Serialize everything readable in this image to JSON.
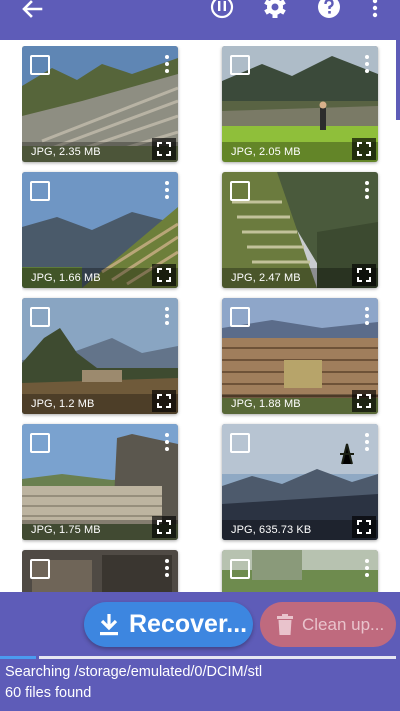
{
  "toolbar": {
    "back_icon": "arrow-back-icon",
    "pause_icon": "pause-circle-icon",
    "settings_icon": "gear-icon",
    "help_icon": "help-circle-icon",
    "menu_icon": "more-vertical-icon"
  },
  "photos": [
    {
      "label": "JPG, 2.35 MB",
      "scene": "terraces"
    },
    {
      "label": "JPG, 2.05 MB",
      "scene": "hiker-terraces"
    },
    {
      "label": "JPG, 1.66 MB",
      "scene": "valley-ruins"
    },
    {
      "label": "JPG, 2.47 MB",
      "scene": "steep-terraces"
    },
    {
      "label": "JPG, 1.2 MB",
      "scene": "peak"
    },
    {
      "label": "JPG, 1.88 MB",
      "scene": "stone-walls"
    },
    {
      "label": "JPG, 1.75 MB",
      "scene": "ruin-wall"
    },
    {
      "label": "JPG, 635.73 KB",
      "scene": "sunset-mountains"
    },
    {
      "label": "",
      "scene": "partial-1"
    },
    {
      "label": "",
      "scene": "partial-2"
    }
  ],
  "actions": {
    "recover_label": "Recover...",
    "cleanup_label": "Clean up...",
    "recover_icon": "download-icon",
    "cleanup_icon": "trash-icon"
  },
  "progress": {
    "fraction": 0.09
  },
  "status": {
    "path": "Searching /storage/emulated/0/DCIM/stl",
    "count": "60 files found"
  },
  "colors": {
    "primary": "#5e5cb8",
    "recover": "#3d86e0",
    "cleanup": "#bf6a7e",
    "progress": "#4b9bf0"
  }
}
